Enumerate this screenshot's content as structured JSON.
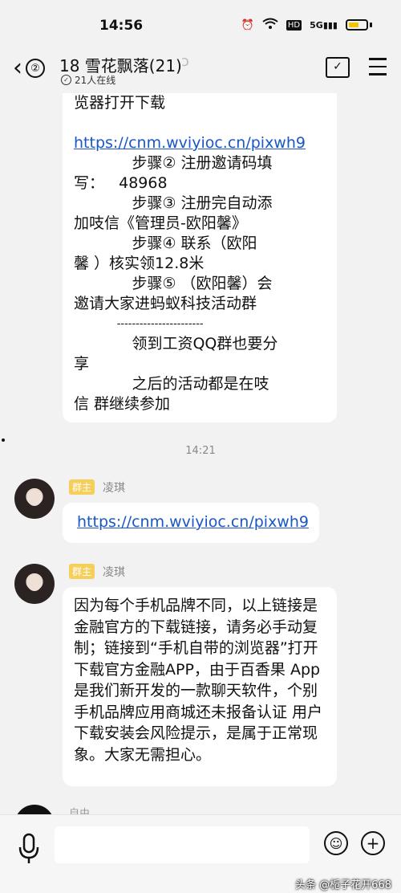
{
  "status": {
    "time": "14:56",
    "icons": [
      "alarm-icon",
      "wifi-icon",
      "hd-icon",
      "5g-signal-icon",
      "battery-icon"
    ],
    "hd": "HD",
    "net": "5G"
  },
  "header": {
    "back_count": "②",
    "title": "18 雪花飘落(21)",
    "online": "21人在线"
  },
  "messages": {
    "first_lines": [
      "览器打开下载",
      "",
      "https://cnm.wviyioc.cn/pixwh9",
      "            步骤② 注册邀请码填",
      "写：   48968",
      "            步骤③ 注册完自动添",
      "加吱信《管理员-欧阳馨》",
      "            步骤④ 联系（欧阳",
      "馨 ）核实领12.8米",
      "            步骤⑤ （欧阳馨）会",
      "邀请大家进蚂蚁科技活动群",
      "             -----------------------",
      "            领到工资QQ群也要分",
      "享",
      "            之后的活动都是在吱",
      "信 群继续参加"
    ],
    "timestamp": "14:21",
    "msg2": {
      "role": "群主",
      "name": "凌琪",
      "link": "https://cnm.wviyioc.cn/pixwh9"
    },
    "msg3": {
      "role": "群主",
      "name": "凌琪",
      "text": "因为每个手机品牌不同，以上链接是金融官方的下载链接，请务必手动复制；链接到“手机自带的浏览器”打开下载官方金融APP，由于百香果 App是我们新开发的一款聊天软件，个别手机品牌应用商城还未报备认证 用户下载安装会风险提示，是属于正常现象。大家无需担心。"
    },
    "partial_name": "自由"
  },
  "bottom": {
    "watermark": "头条 @栀子花开668"
  }
}
